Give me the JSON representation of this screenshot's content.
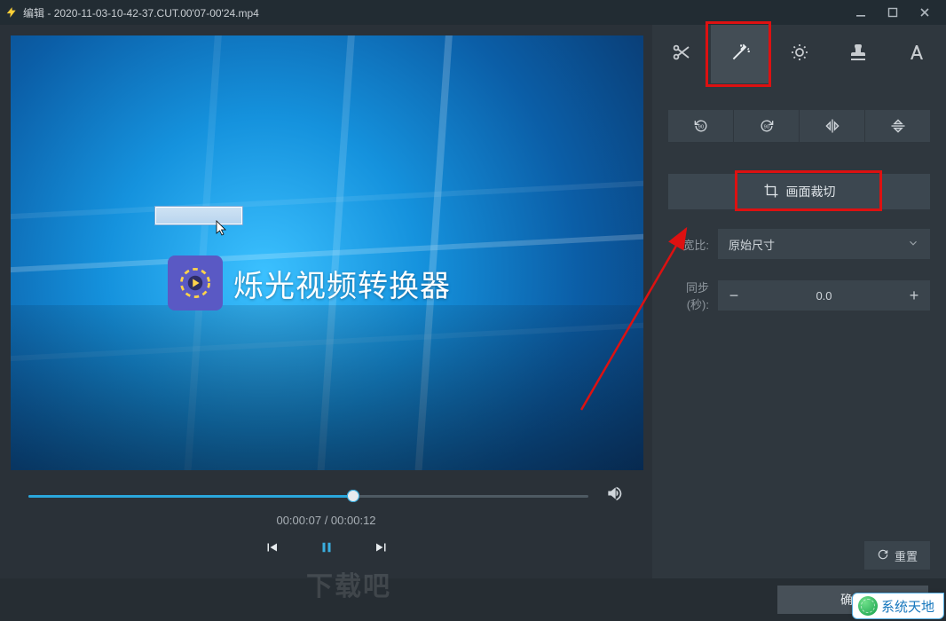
{
  "titlebar": {
    "app": "编辑",
    "separator": " - ",
    "filename": "2020-11-03-10-42-37.CUT.00'07-00'24.mp4"
  },
  "preview": {
    "brand_text": "烁光视频转换器",
    "current_time": "00:00:07",
    "total_time": "00:00:12",
    "progress_pct": 58
  },
  "side": {
    "tabs": {
      "cut": "scissors-icon",
      "effects": "wand-icon",
      "adjust": "brightness-icon",
      "watermark": "stamp-icon",
      "text": "text-icon"
    },
    "crop_label": "画面裁切",
    "aspect": {
      "label": "宽比:",
      "value": "原始尺寸"
    },
    "sync": {
      "label": "同步(秒):",
      "value": "0.0"
    },
    "reset": "重置"
  },
  "footer": {
    "ok": "确定"
  },
  "watermarks": {
    "dl": "下载吧",
    "site": "系统天地"
  }
}
